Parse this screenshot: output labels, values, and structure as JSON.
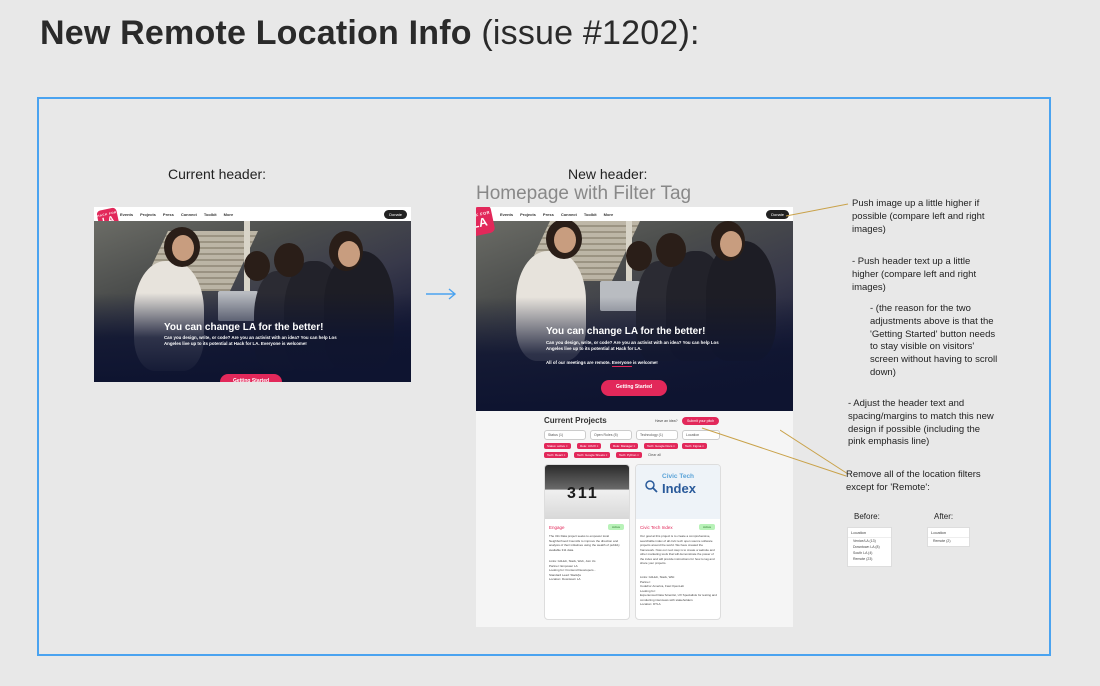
{
  "title": {
    "main": "New Remote Location Info",
    "issue": "(issue #1202):"
  },
  "labels": {
    "current_header": "Current header:",
    "new_header": "New header:",
    "new_header_sub": "Homepage with Filter Tag"
  },
  "nav": {
    "items": [
      "Events",
      "Projects",
      "Press",
      "Connect",
      "Toolkit",
      "More"
    ],
    "donate": "Donate"
  },
  "logo": {
    "small": "HACK FOR",
    "big": "LA"
  },
  "hero": {
    "headline": "You can change LA for the better!",
    "body": "Can you design, write, or code? Are you an activist with an idea? You can help Los Angeles live up to its potential at Hack for LA. Everyone is welcome!",
    "body_new": "Can you design, write, or code? Are you an activist with an idea? You can help Los Angeles live up to its potential at Hack for LA.",
    "remote_line": "All of our meetings are remote. Everyone is welcome!",
    "button": "Getting Started"
  },
  "projects": {
    "title": "Current Projects",
    "have_idea": "Have an idea?",
    "submit": "Submit your pitch",
    "selects": [
      "Status (1)",
      "Open Roles (5)",
      "Technology (1)",
      "Location"
    ],
    "chips_row1": [
      "Status: active ×",
      "Role: UI/UX ×",
      "Role: Manager ×",
      "Tech: Google Docs ×",
      "Tech: Figma ×"
    ],
    "chips_row2": [
      "Tech: React ×",
      "Tech: Google Sheets ×",
      "Tech: Python ×"
    ],
    "clear_all": "Clear all",
    "cards": [
      {
        "image_text": "311",
        "name": "Engage",
        "status": "Active",
        "body": "The 311 Data project seeks to empower local Neighborhood Councils to improve the direction and analysis of their initiatives using the wealth of publicly available 311 data.",
        "meta": "Links: GitHub, Slack, Web, Join Us\nPartner: Empower LA\nLooking for: Frontend Developers...\nStandard Lead: Slack/ja\nLocation: Downtown LA"
      },
      {
        "image_text": "Index",
        "image_caption": "Civic Tech",
        "name": "Civic Tech Index",
        "status": "Active",
        "body": "Our goal at this project is to create a comprehensive, searchable index of all civic tech open source software projects around the world. We have created the framework. Now our next step is to create a website and other marketing tools that will demonstrate the power of the index and will provide instructions for how to tag and share your projects.",
        "meta": "Links: GitHub, Slack, Wiki\nPartner:\nCodeFor America, Fast OpenLab\nLooking for:\nExperienced Data Scientist, UX Specialists for testing and conducting interviews with stakeholders\nLocation: DTLA"
      }
    ]
  },
  "notes": [
    "Push image up a little higher if possible (compare left and right images)",
    "- Push header text up a little higher (compare left and right images)",
    "- (the reason for the two adjustments above is that the 'Getting Started' button needs to stay visible on visitors' screen without having to scroll down)",
    "- Adjust the header text and spacing/margins to match this new design if possible (including the pink emphasis line)",
    "Remove all of the location filters except for 'Remote':"
  ],
  "before_after": {
    "before_label": "Before:",
    "after_label": "After:",
    "dropdown_title": "Location",
    "before_options": [
      "Venice/LA (13)",
      "Downtown LA (8)",
      "South LA (4)",
      "Remote (23)"
    ],
    "after_options": [
      "Remote (2)"
    ]
  },
  "colors": {
    "accent": "#e2285a",
    "frame": "#4aa3f0",
    "navy": "#0e1430"
  }
}
